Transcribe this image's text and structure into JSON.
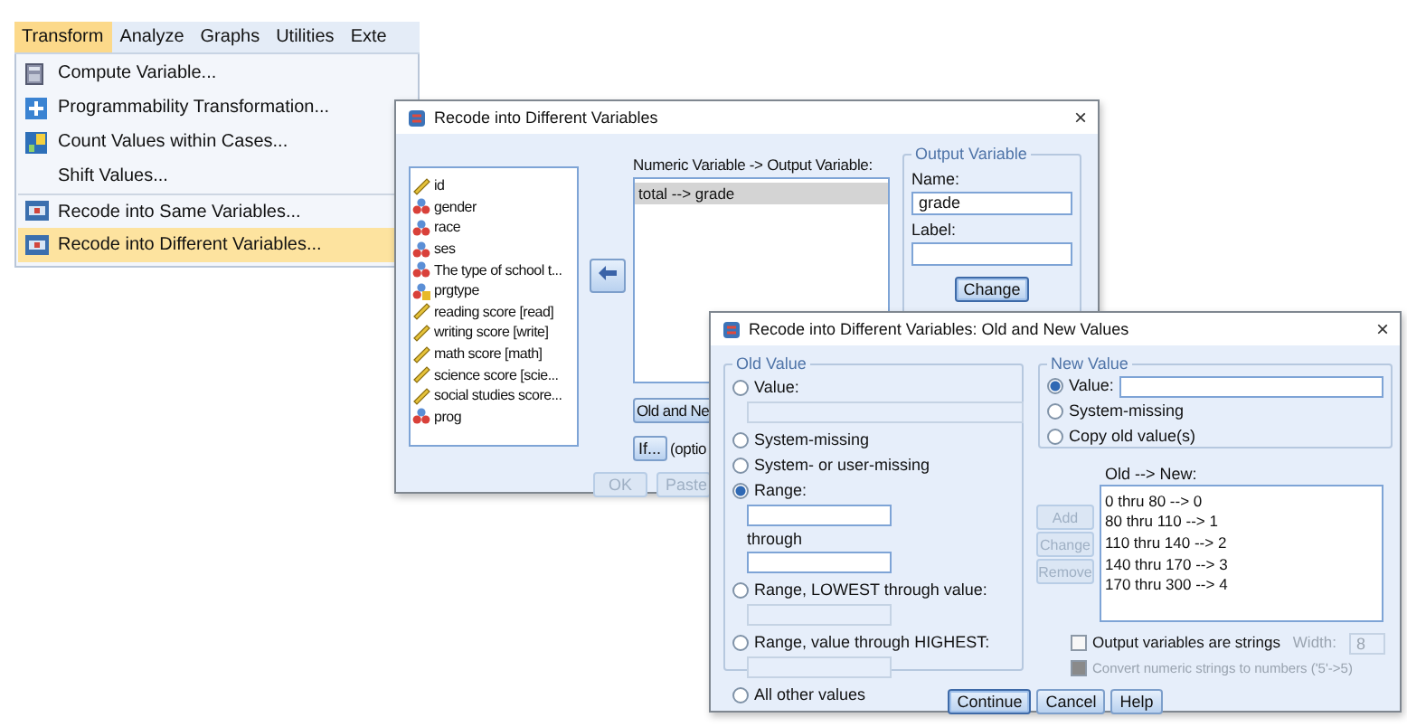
{
  "menu_bar": [
    {
      "label": "Transform",
      "selected": true
    },
    {
      "label": "Analyze",
      "selected": false
    },
    {
      "label": "Graphs",
      "selected": false
    },
    {
      "label": "Utilities",
      "selected": false
    },
    {
      "label": "Exte",
      "selected": false
    }
  ],
  "menu": {
    "items": [
      {
        "label": "Compute Variable...",
        "kind": "calculator",
        "separator_before": false,
        "selected": false
      },
      {
        "label": "Programmability Transformation...",
        "kind": "plus",
        "separator_before": false,
        "selected": false
      },
      {
        "label": "Count Values within Cases...",
        "kind": "count",
        "separator_before": false,
        "selected": false
      },
      {
        "label": "Shift Values...",
        "kind": "plain",
        "separator_before": false,
        "selected": false
      },
      {
        "label": "Recode into Same Variables...",
        "kind": "recode",
        "separator_before": true,
        "selected": false
      },
      {
        "label": "Recode into Different Variables...",
        "kind": "recode",
        "separator_before": false,
        "selected": true
      }
    ]
  },
  "recode_dialog": {
    "title": "Recode into Different Variables",
    "close": "×",
    "variables": [
      {
        "name": "id",
        "kind": "scale"
      },
      {
        "name": "gender",
        "kind": "nominal"
      },
      {
        "name": "race",
        "kind": "nominal"
      },
      {
        "name": "ses",
        "kind": "nominal"
      },
      {
        "name": "The type of school t...",
        "kind": "nominal"
      },
      {
        "name": "prgtype",
        "kind": "string"
      },
      {
        "name": "reading score [read]",
        "kind": "scale"
      },
      {
        "name": "writing score [write]",
        "kind": "scale"
      },
      {
        "name": "math score [math]",
        "kind": "scale"
      },
      {
        "name": "science score [scie...",
        "kind": "scale"
      },
      {
        "name": "social studies score...",
        "kind": "scale"
      },
      {
        "name": "prog",
        "kind": "nominal"
      }
    ],
    "target_label": "Numeric Variable -> Output Variable:",
    "target_items": [
      {
        "text": "total --> grade",
        "selected": true
      }
    ],
    "output_group": {
      "title": "Output Variable",
      "name_label": "Name:",
      "name_value": "grade",
      "label_label": "Label:",
      "change_button": "Change"
    },
    "old_new_button": "Old and Ne",
    "if_button": "If...",
    "if_hint": "(optio",
    "buttons": [
      {
        "label": "OK",
        "disabled": true
      },
      {
        "label": "Paste",
        "disabled": true
      }
    ]
  },
  "values_dialog": {
    "title": "Recode into Different Variables: Old and New Values",
    "close": "×",
    "old_value": {
      "title": "Old Value",
      "options": [
        {
          "label": "Value:",
          "selected": false,
          "fields": [
            {
              "disabled": true
            }
          ]
        },
        {
          "label": "System-missing",
          "selected": false
        },
        {
          "label": "System- or user-missing",
          "selected": false
        },
        {
          "label": "Range:",
          "selected": true,
          "fields": [
            {
              "disabled": false
            },
            {
              "caption": "through",
              "disabled": false
            }
          ]
        },
        {
          "label": "Range, LOWEST through value:",
          "selected": false,
          "fields": [
            {
              "disabled": true
            }
          ]
        },
        {
          "label": "Range, value through HIGHEST:",
          "selected": false,
          "fields": [
            {
              "disabled": true
            }
          ]
        },
        {
          "label": "All other values",
          "selected": false
        }
      ]
    },
    "new_value": {
      "title": "New Value",
      "options": [
        {
          "label": "Value:",
          "selected": true,
          "fields": [
            {
              "disabled": false
            }
          ]
        },
        {
          "label": "System-missing",
          "selected": false
        },
        {
          "label": "Copy old value(s)",
          "selected": false
        }
      ]
    },
    "side_buttons": [
      {
        "label": "Add",
        "disabled": true
      },
      {
        "label": "Change",
        "disabled": true
      },
      {
        "label": "Remove",
        "disabled": true
      }
    ],
    "list_label": "Old --> New:",
    "list_items": [
      "0 thru 80 --> 0",
      "80 thru 110 --> 1",
      "110 thru 140 --> 2",
      "140 thru 170 --> 3",
      "170 thru 300 --> 4"
    ],
    "checkboxes": [
      {
        "label": "Output variables are strings",
        "checked": false,
        "disabled": false
      },
      {
        "label": "Convert numeric strings to numbers ('5'->5)",
        "checked": false,
        "disabled": true
      }
    ],
    "width_label": "Width:",
    "width_value": "8",
    "buttons": [
      {
        "label": "Continue",
        "default": true
      },
      {
        "label": "Cancel",
        "default": false
      },
      {
        "label": "Help",
        "default": false
      }
    ]
  }
}
